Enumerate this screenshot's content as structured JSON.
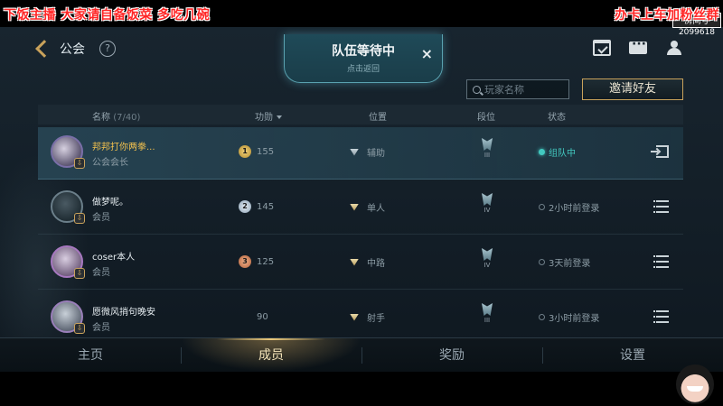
{
  "overlay": {
    "left_text": "下饭主播 大家请自备饭菜 多吃几碗",
    "right_text": "办卡上车加粉丝群",
    "room_label": "房间号",
    "room_number": "2099618"
  },
  "header": {
    "back_label": "公会",
    "help_glyph": "?",
    "queue_title": "队伍等待中",
    "queue_subtitle": "点击返回",
    "queue_close": "×"
  },
  "toolbar": {
    "search_placeholder": "玩家名称",
    "invite_label": "邀请好友"
  },
  "table": {
    "columns": {
      "name": "名称",
      "count": "(7/40)",
      "score": "功勋",
      "position": "位置",
      "tier": "段位",
      "status": "状态"
    },
    "rows": [
      {
        "name": "邦邦打你两拳...",
        "role": "公会会长",
        "medal": "1",
        "medal_type": "gold",
        "score": "155",
        "position": "辅助",
        "pos_icon": "support",
        "tier": "III",
        "status": "组队中",
        "status_active": true,
        "action": "exit-icon"
      },
      {
        "name": "做梦呢。",
        "role": "会员",
        "medal": "2",
        "medal_type": "silver",
        "score": "145",
        "position": "单人",
        "pos_icon": "solo",
        "tier": "IV",
        "status": "2小时前登录",
        "status_active": false,
        "action": "menu-icon"
      },
      {
        "name": "coser本人",
        "role": "会员",
        "medal": "3",
        "medal_type": "bronze",
        "score": "125",
        "position": "中路",
        "pos_icon": "mid",
        "tier": "IV",
        "status": "3天前登录",
        "status_active": false,
        "action": "menu-icon"
      },
      {
        "name": "愿微风捎句晚安",
        "role": "会员",
        "medal": "",
        "medal_type": "none",
        "score": "90",
        "position": "射手",
        "pos_icon": "marksman",
        "tier": "III",
        "status": "3小时前登录",
        "status_active": false,
        "action": "menu-icon"
      }
    ]
  },
  "tabs": [
    {
      "label": "主页",
      "active": false
    },
    {
      "label": "成员",
      "active": true
    },
    {
      "label": "奖励",
      "active": false
    },
    {
      "label": "设置",
      "active": false
    }
  ]
}
